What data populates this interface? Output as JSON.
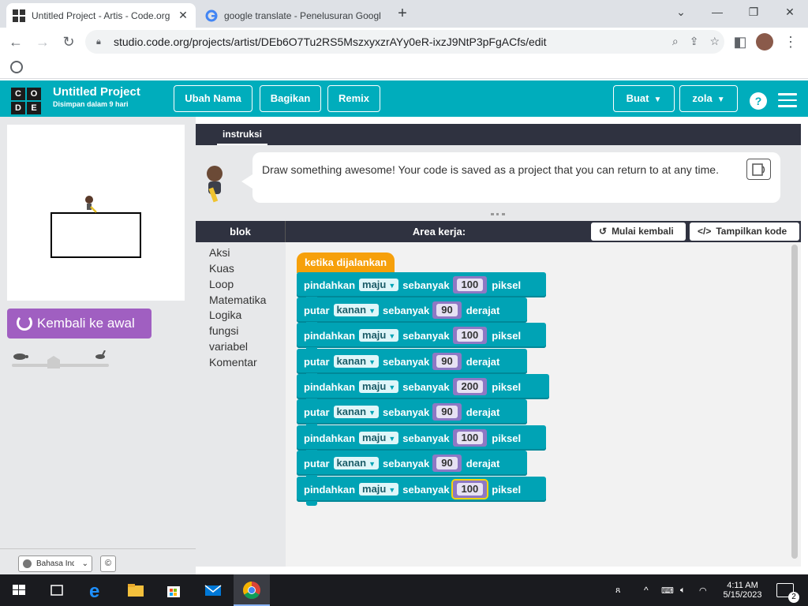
{
  "browser": {
    "tabs": [
      {
        "title": "Untitled Project - Artis - Code.org",
        "active": true,
        "icon": "codeorg-favicon"
      },
      {
        "title": "google translate - Penelusuran Google",
        "active": false,
        "icon": "google-icon"
      }
    ],
    "new_tab": "+",
    "url": "studio.code.org/projects/artist/DEb6O7Tu2RS5MszxyxzrAYy0eR-ixzJ9NtP3pFgACfs/edit"
  },
  "app": {
    "logo_letters": [
      "C",
      "O",
      "D",
      "E"
    ],
    "project_title": "Untitled Project",
    "saved_status": "Disimpan dalam 9 hari",
    "buttons": {
      "rename": "Ubah Nama",
      "share": "Bagikan",
      "remix": "Remix",
      "create": "Buat",
      "user": "zola",
      "help": "?"
    },
    "accent": "#00adbc"
  },
  "left": {
    "reset_button": "Kembali ke awal",
    "language": "Bahasa Indonesia",
    "copyright": "©"
  },
  "instructions": {
    "tab": "instruksi",
    "text": "Draw something awesome! Your code is saved as a project that you can return to at any time."
  },
  "workspace": {
    "toolbox_header": "blok",
    "area_header": "Area kerja:",
    "start_over": "Mulai kembali",
    "show_code": "Tampilkan kode",
    "categories": [
      "Aksi",
      "Kuas",
      "Loop",
      "Matematika",
      "Logika",
      "fungsi",
      "variabel",
      "Komentar"
    ],
    "hat_block": "ketika dijalankan",
    "blocks": [
      {
        "verb": "pindahkan",
        "dir": "maju",
        "by": "sebanyak",
        "value": "100",
        "unit": "piksel"
      },
      {
        "verb": "putar",
        "dir": "kanan",
        "by": "sebanyak",
        "value": "90",
        "unit": "derajat"
      },
      {
        "verb": "pindahkan",
        "dir": "maju",
        "by": "sebanyak",
        "value": "100",
        "unit": "piksel"
      },
      {
        "verb": "putar",
        "dir": "kanan",
        "by": "sebanyak",
        "value": "90",
        "unit": "derajat"
      },
      {
        "verb": "pindahkan",
        "dir": "maju",
        "by": "sebanyak",
        "value": "200",
        "unit": "piksel"
      },
      {
        "verb": "putar",
        "dir": "kanan",
        "by": "sebanyak",
        "value": "90",
        "unit": "derajat"
      },
      {
        "verb": "pindahkan",
        "dir": "maju",
        "by": "sebanyak",
        "value": "100",
        "unit": "piksel"
      },
      {
        "verb": "putar",
        "dir": "kanan",
        "by": "sebanyak",
        "value": "90",
        "unit": "derajat"
      },
      {
        "verb": "pindahkan",
        "dir": "maju",
        "by": "sebanyak",
        "value": "100",
        "unit": "piksel"
      }
    ]
  },
  "taskbar": {
    "time": "4:11 AM",
    "date": "5/15/2023",
    "notifications": "2"
  }
}
